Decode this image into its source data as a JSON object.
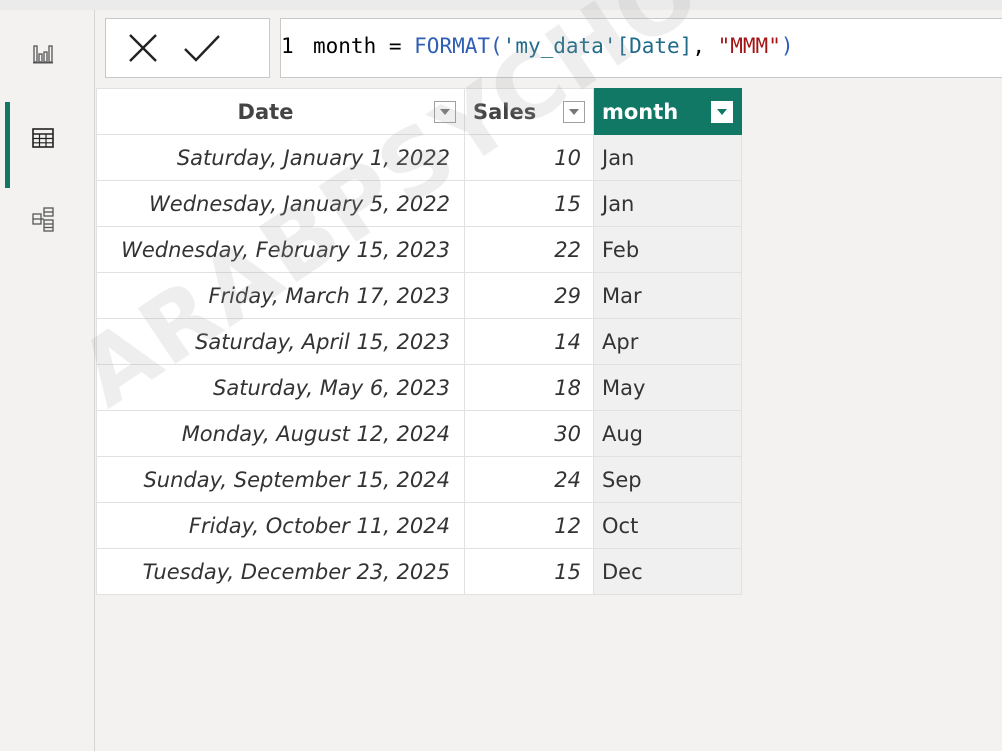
{
  "formula": {
    "line_number": "1",
    "column_name": "month",
    "operator": " = ",
    "function": "FORMAT(",
    "table_ref": "'my_data'",
    "column_ref": "[Date]",
    "separator": ", ",
    "format_string": "\"MMM\"",
    "close": ")"
  },
  "table": {
    "headers": {
      "date": "Date",
      "sales": "Sales",
      "month": "month"
    },
    "rows": [
      {
        "date": "Saturday, January 1, 2022",
        "sales": "10",
        "month": "Jan"
      },
      {
        "date": "Wednesday, January 5, 2022",
        "sales": "15",
        "month": "Jan"
      },
      {
        "date": "Wednesday, February 15, 2023",
        "sales": "22",
        "month": "Feb"
      },
      {
        "date": "Friday, March 17, 2023",
        "sales": "29",
        "month": "Mar"
      },
      {
        "date": "Saturday, April 15, 2023",
        "sales": "14",
        "month": "Apr"
      },
      {
        "date": "Saturday, May 6, 2023",
        "sales": "18",
        "month": "May"
      },
      {
        "date": "Monday, August 12, 2024",
        "sales": "30",
        "month": "Aug"
      },
      {
        "date": "Sunday, September 15, 2024",
        "sales": "24",
        "month": "Sep"
      },
      {
        "date": "Friday, October 11, 2024",
        "sales": "12",
        "month": "Oct"
      },
      {
        "date": "Tuesday, December 23, 2025",
        "sales": "15",
        "month": "Dec"
      }
    ]
  },
  "watermark": "ARABPSYCHO",
  "icons": {
    "report_view": "bar-chart-icon",
    "table_view": "table-grid-icon",
    "model_view": "model-diagram-icon",
    "cancel": "close-icon",
    "commit": "checkmark-icon",
    "filter": "chevron-down-icon"
  },
  "colors": {
    "accent": "#117865",
    "function": "#2f5fb4",
    "string": "#a31515"
  }
}
